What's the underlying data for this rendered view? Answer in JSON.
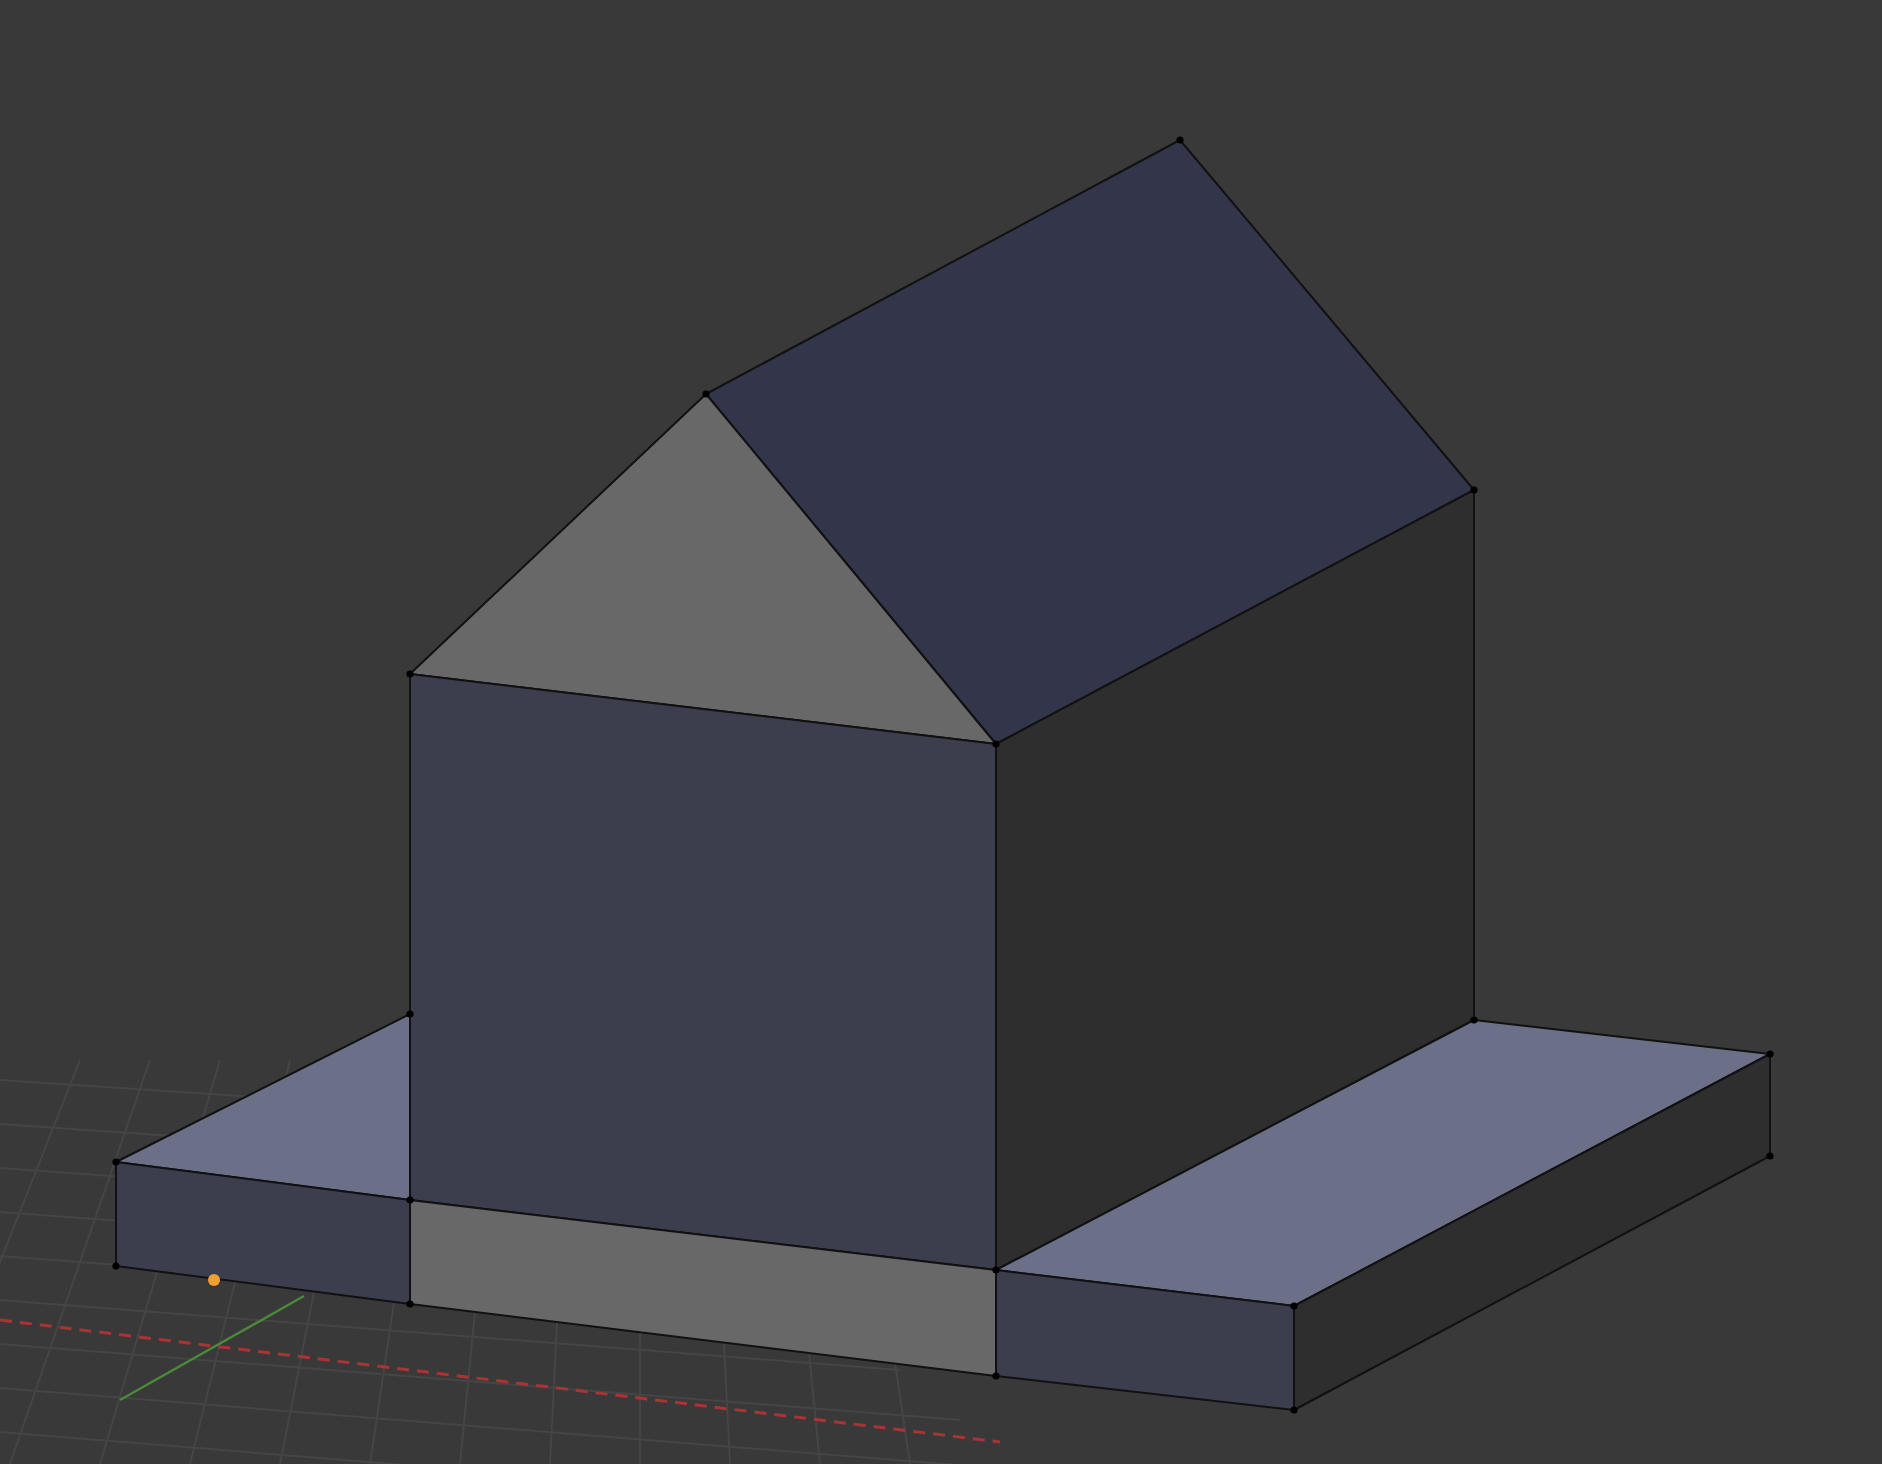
{
  "viewport": {
    "vertices_shown": true
  }
}
